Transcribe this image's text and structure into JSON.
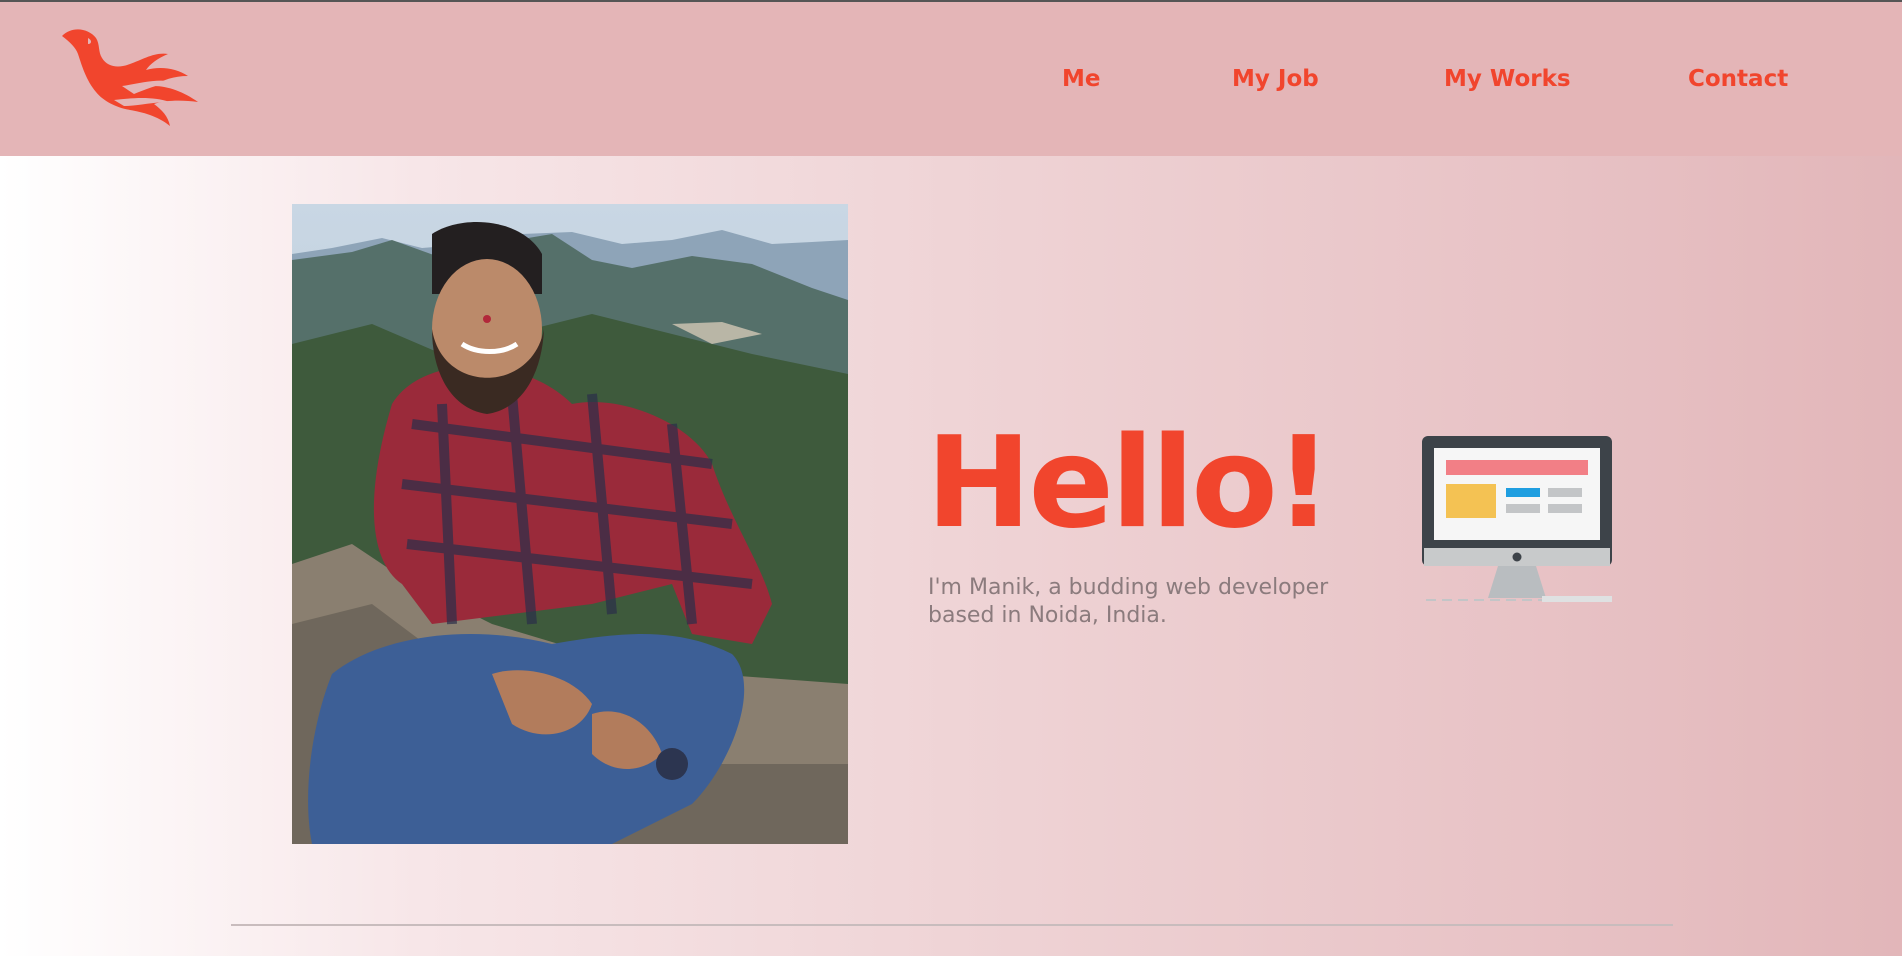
{
  "nav": {
    "links": [
      "Me",
      "My Job",
      "My Works",
      "Contact"
    ]
  },
  "hero": {
    "greeting": "Hello!",
    "intro": "I'm Manik, a budding web developer based in Noida, India."
  },
  "colors": {
    "accent": "#f1452d",
    "navbar_bg": "#e4b5b7",
    "text_muted": "#8b7b7d"
  },
  "icons": {
    "logo": "phoenix-logo-icon",
    "illustration": "desktop-monitor-icon"
  }
}
